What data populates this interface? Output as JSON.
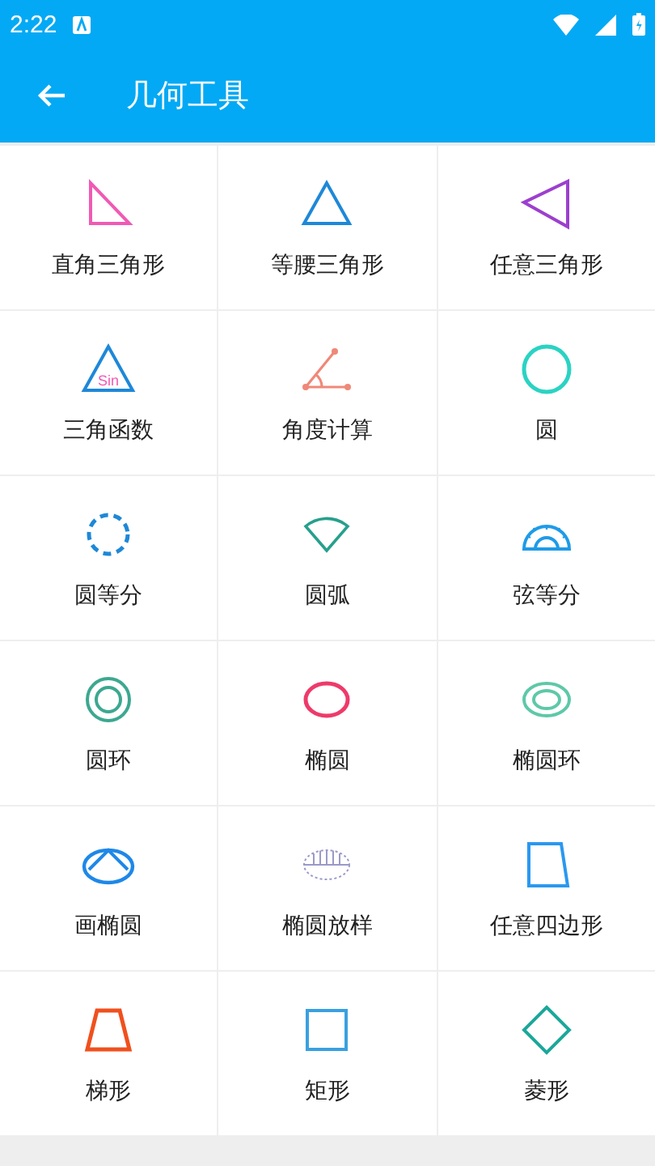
{
  "status_bar": {
    "time": "2:22"
  },
  "toolbar": {
    "title": "几何工具"
  },
  "tools": [
    {
      "label": "直角三角形",
      "kind": "right"
    },
    {
      "label": "等腰三角形",
      "kind": "isosceles"
    },
    {
      "label": "任意三角形",
      "kind": "scalene"
    },
    {
      "label": "三角函数",
      "kind": "sine",
      "icon_text": "Sin"
    },
    {
      "label": "角度计算",
      "kind": "angle"
    },
    {
      "label": "圆",
      "kind": "circle"
    },
    {
      "label": "圆等分",
      "kind": "dashed"
    },
    {
      "label": "圆弧",
      "kind": "sector"
    },
    {
      "label": "弦等分",
      "kind": "protractor"
    },
    {
      "label": "圆环",
      "kind": "ring"
    },
    {
      "label": "椭圆",
      "kind": "ellipse"
    },
    {
      "label": "椭圆环",
      "kind": "annulus"
    },
    {
      "label": "画椭圆",
      "kind": "sketch"
    },
    {
      "label": "椭圆放样",
      "kind": "lofting"
    },
    {
      "label": "任意四边形",
      "kind": "quad"
    },
    {
      "label": "梯形",
      "kind": "trapezoid"
    },
    {
      "label": "矩形",
      "kind": "square"
    },
    {
      "label": "菱形",
      "kind": "rhombus"
    }
  ]
}
